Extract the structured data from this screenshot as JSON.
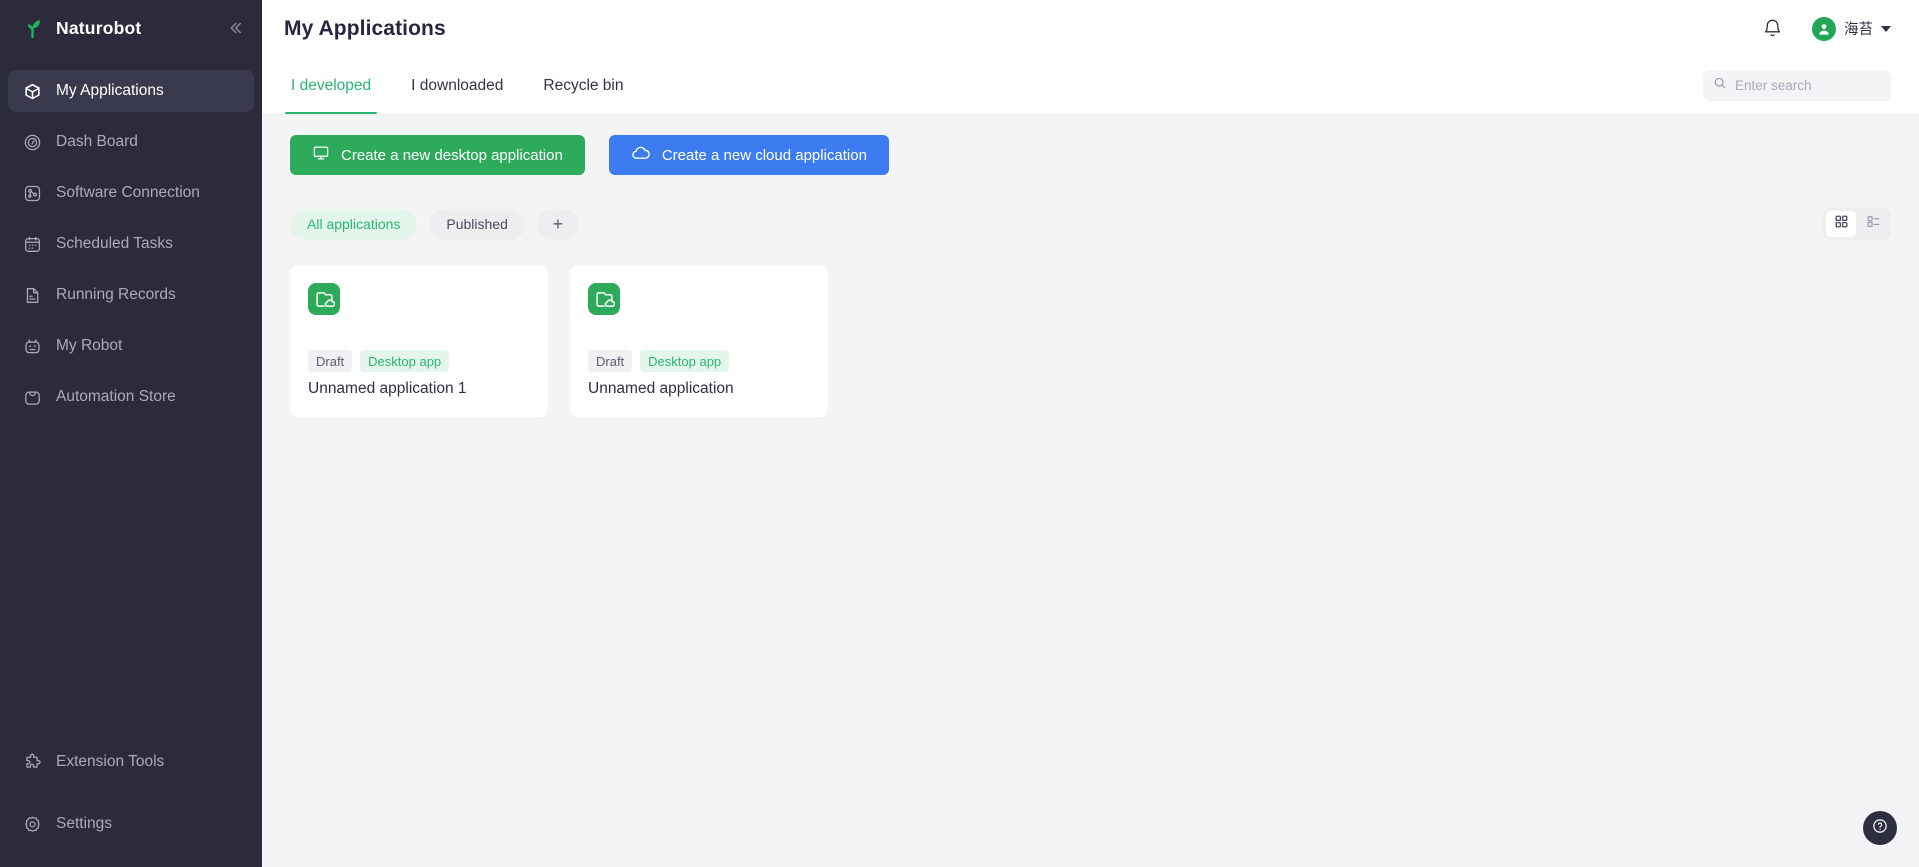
{
  "brand": {
    "name": "Naturobot",
    "logo_icon": "sprout-icon",
    "collapse_icon": "chevron-double-left-icon"
  },
  "sidebar": {
    "items_top": [
      {
        "label": "My Applications",
        "icon": "cube-icon",
        "active": true
      },
      {
        "label": "Dash Board",
        "icon": "dashboard-gauge-icon",
        "active": false
      },
      {
        "label": "Software Connection",
        "icon": "software-connection-icon",
        "active": false
      },
      {
        "label": "Scheduled Tasks",
        "icon": "calendar-icon",
        "active": false
      },
      {
        "label": "Running Records",
        "icon": "document-list-icon",
        "active": false
      },
      {
        "label": "My Robot",
        "icon": "robot-icon",
        "active": false
      },
      {
        "label": "Automation Store",
        "icon": "shopping-bag-icon",
        "active": false
      }
    ],
    "items_bottom": [
      {
        "label": "Extension Tools",
        "icon": "puzzle-piece-icon",
        "active": false
      },
      {
        "label": "Settings",
        "icon": "gear-icon",
        "active": false
      }
    ]
  },
  "header": {
    "title": "My Applications",
    "bell_icon": "bell-icon",
    "user": {
      "name": "海苔",
      "avatar_icon": "user-avatar-icon",
      "caret_icon": "chevron-down-icon"
    }
  },
  "tabs": [
    {
      "label": "I developed",
      "active": true
    },
    {
      "label": "I downloaded",
      "active": false
    },
    {
      "label": "Recycle bin",
      "active": false
    }
  ],
  "search": {
    "placeholder": "Enter search",
    "value": "",
    "icon": "search-icon"
  },
  "actions": {
    "desktop_label": "Create a new desktop application",
    "desktop_icon": "monitor-icon",
    "cloud_label": "Create a new cloud application",
    "cloud_icon": "cloud-icon"
  },
  "filters": {
    "chips": [
      {
        "label": "All applications",
        "active": true
      },
      {
        "label": "Published",
        "active": false
      }
    ],
    "add_label": "+",
    "views": [
      {
        "name": "grid-view",
        "icon": "grid-icon",
        "active": true
      },
      {
        "name": "list-view",
        "icon": "list-icon",
        "active": false
      }
    ]
  },
  "cards": [
    {
      "icon": "folder-cloud-icon",
      "status_tag": "Draft",
      "type_tag": "Desktop app",
      "title": "Unnamed application 1"
    },
    {
      "icon": "folder-cloud-icon",
      "status_tag": "Draft",
      "type_tag": "Desktop app",
      "title": "Unnamed application"
    }
  ],
  "help": {
    "icon": "question-circle-icon"
  },
  "colors": {
    "sidebar_bg": "#2b2b3c",
    "accent_green": "#2ab673",
    "button_green": "#2eab5a",
    "button_blue": "#3c7cf0",
    "page_bg": "#f4f4f6"
  }
}
